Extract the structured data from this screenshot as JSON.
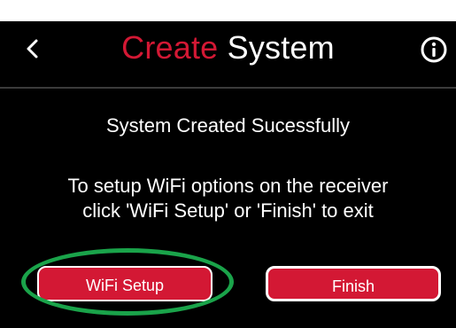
{
  "header": {
    "title_accent": "Create",
    "title_rest": "System"
  },
  "icons": {
    "back": "chevron-left-icon",
    "info": "info-circle-icon"
  },
  "content": {
    "status": "System Created Sucessfully",
    "instructions": "To setup WiFi options on the receiver\nclick 'WiFi Setup' or 'Finish' to exit"
  },
  "buttons": {
    "wifi_setup": "WiFi Setup",
    "finish": "Finish"
  },
  "colors": {
    "accent": "#d31834",
    "background": "#000000",
    "text": "#ffffff",
    "highlight": "#1aa34a"
  }
}
